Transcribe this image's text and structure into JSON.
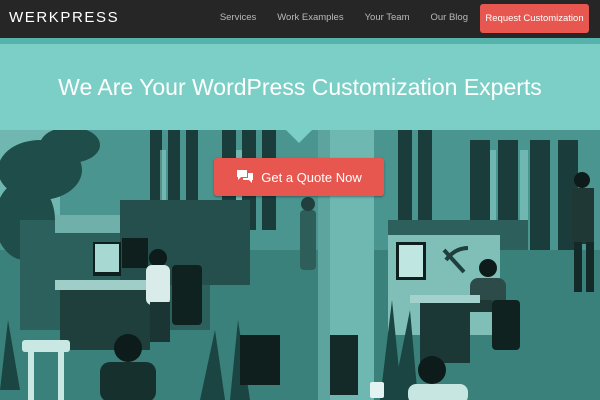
{
  "header": {
    "logo": "WERKPRESS",
    "nav": [
      {
        "label": "Services"
      },
      {
        "label": "Work Examples"
      },
      {
        "label": "Your Team"
      },
      {
        "label": "Our Blog"
      }
    ],
    "cta_label": "Request Customization"
  },
  "hero": {
    "title": "We Are Your WordPress Customization Experts",
    "button_label": "Get a Quote Now",
    "button_icon": "chat-bubbles-icon"
  },
  "colors": {
    "nav_bg": "#262626",
    "accent": "#e8574f",
    "hero_band": "#7ccfc6",
    "stripe": "#56b3ac",
    "photo_tint": "#2f6d6a"
  }
}
